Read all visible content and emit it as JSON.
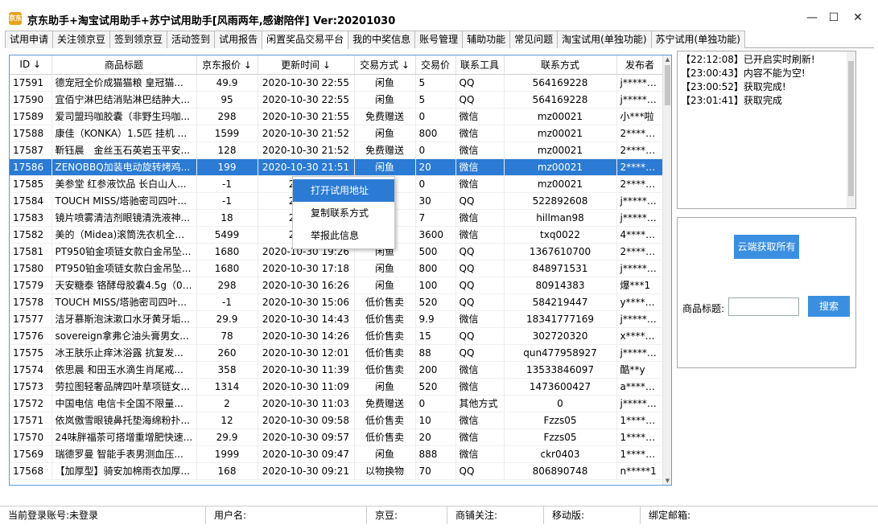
{
  "window": {
    "title": "京东助手+淘宝试用助手+苏宁试用助手[风雨两年,感谢陪伴] Ver:20201030",
    "icon_text": "京东"
  },
  "tabs": [
    {
      "label": "试用申请"
    },
    {
      "label": "关注领京豆"
    },
    {
      "label": "签到领京豆"
    },
    {
      "label": "活动签到"
    },
    {
      "label": "试用报告"
    },
    {
      "label": "闲置奖品交易平台",
      "active": true
    },
    {
      "label": "我的中奖信息"
    },
    {
      "label": "账号管理"
    },
    {
      "label": "辅助功能"
    },
    {
      "label": "常见问题"
    },
    {
      "label": "淘宝试用(单独功能)"
    },
    {
      "label": "苏宁试用(单独功能)"
    }
  ],
  "table": {
    "headers": [
      "ID ↓",
      "商品标题",
      "京东报价 ↓",
      "更新时间 ↓",
      "交易方式 ↓",
      "交易价",
      "联系工具",
      "联系方式",
      "发布者"
    ],
    "rows": [
      [
        "17591",
        "德宠冠全价成猫猫粮 皇冠猫...",
        "49.9",
        "2020-10-30 22:55",
        "闲鱼",
        "5",
        "QQ",
        "564169228",
        "j********"
      ],
      [
        "17590",
        "宜佰宁淋巴结消贴淋巴结肿大...",
        "95",
        "2020-10-30 22:55",
        "闲鱼",
        "5",
        "QQ",
        "564169228",
        "j********"
      ],
      [
        "17589",
        "爱司盟玛咖胶囊（非野生玛咖...",
        "298",
        "2020-10-30 21:55",
        "免费赠送",
        "0",
        "微信",
        "mz00021",
        "小***啦"
      ],
      [
        "17588",
        "康佳（KONKA）1.5匹 挂机 ...",
        "1599",
        "2020-10-30 21:52",
        "闲鱼",
        "800",
        "微信",
        "mz00021",
        "2********"
      ],
      [
        "17587",
        "靳钰晨　金丝玉石英岩玉平安...",
        "128",
        "2020-10-30 21:52",
        "免费赠送",
        "0",
        "微信",
        "mz00021",
        "2********"
      ],
      [
        "17586",
        "ZENOBBQ加装电动旋转烤鸡...",
        "199",
        "2020-10-30 21:51",
        "闲鱼",
        "20",
        "微信",
        "mz00021",
        "2********"
      ],
      [
        "17585",
        "美参堂 红参液饮品 长白山人...",
        "-1",
        "2020-1",
        "",
        "0",
        "微信",
        "mz00021",
        "2********"
      ],
      [
        "17584",
        "TOUCH MISS/塔驰密司四叶...",
        "-1",
        "2020-1",
        "",
        "30",
        "QQ",
        "522892608",
        "j********"
      ],
      [
        "17583",
        "镜片喷雾清洁剂眼镜清洗液神...",
        "18",
        "2020-1",
        "",
        "7",
        "微信",
        "hillman98",
        "j********"
      ],
      [
        "17582",
        "美的（Midea)滚筒洗衣机全自...",
        "5499",
        "2020-1",
        "",
        "3600",
        "微信",
        "txq0022",
        "4********"
      ],
      [
        "17581",
        "PT950铂金项链女款白金吊坠...",
        "1680",
        "2020-10-30 19:26",
        "闲鱼",
        "500",
        "QQ",
        "1367610700",
        "2********"
      ],
      [
        "17580",
        "PT950铂金项链女款白金吊坠...",
        "1680",
        "2020-10-30 17:18",
        "闲鱼",
        "800",
        "QQ",
        "848971531",
        "j********"
      ],
      [
        "17579",
        "天安糖泰 铬酵母胶囊4.5g（0....",
        "298",
        "2020-10-30 16:26",
        "闲鱼",
        "100",
        "QQ",
        "80914383",
        "爆***1"
      ],
      [
        "17578",
        "TOUCH MISS/塔驰密司四叶...",
        "-1",
        "2020-10-30 15:06",
        "低价售卖",
        "520",
        "QQ",
        "584219447",
        "y********"
      ],
      [
        "17577",
        "洁牙慕斯泡沫漱口水牙黄牙垢...",
        "29.9",
        "2020-10-30 14:43",
        "低价售卖",
        "9.9",
        "微信",
        "18341777169",
        "j********"
      ],
      [
        "17576",
        "sovereign拿弗仑油头膏男女...",
        "78",
        "2020-10-30 14:26",
        "低价售卖",
        "15",
        "QQ",
        "302720320",
        "x********m"
      ],
      [
        "17575",
        "冰王肤乐止痒沐浴露 抗复发...",
        "260",
        "2020-10-30 12:01",
        "低价售卖",
        "88",
        "QQ",
        "qun477958927",
        "j********"
      ],
      [
        "17574",
        "依思晨 和田玉水滴生肖尾戒...",
        "358",
        "2020-10-30 11:39",
        "低价售卖",
        "200",
        "微信",
        "13533846097",
        "酷**y"
      ],
      [
        "17573",
        "劳拉图轻奢品牌四叶草项链女...",
        "1314",
        "2020-10-30 11:09",
        "闲鱼",
        "520",
        "微信",
        "1473600427",
        "a********"
      ],
      [
        "17572",
        "中国电信 电信卡全国不限量...",
        "2",
        "2020-10-30 11:03",
        "免费赠送",
        "0",
        "其他方式",
        "0",
        "j********"
      ],
      [
        "17571",
        "依岚傲雪眼镜鼻托垫海绵粉扑...",
        "12",
        "2020-10-30 09:58",
        "低价售卖",
        "10",
        "微信",
        "Fzzs05",
        "1********"
      ],
      [
        "17570",
        "24味胖福茶可搭增重增肥快速...",
        "29.9",
        "2020-10-30 09:57",
        "低价售卖",
        "20",
        "微信",
        "Fzzs05",
        "1********"
      ],
      [
        "17569",
        "瑞德罗曼 智能手表男测血压...",
        "1999",
        "2020-10-30 09:47",
        "闲鱼",
        "888",
        "微信",
        "ckr0403",
        "1********"
      ],
      [
        "17568",
        "【加厚型】骑安加棉雨衣加厚...",
        "168",
        "2020-10-30 09:21",
        "以物换物",
        "70",
        "QQ",
        "806890748",
        "n*****1"
      ]
    ],
    "selected_index": 5
  },
  "context_menu": {
    "items": [
      "打开试用地址",
      "复制联系方式",
      "举报此信息"
    ],
    "hover_index": 0
  },
  "log": {
    "lines": [
      "【22:12:08】已开启实时刷新!",
      "【23:00:43】内容不能为空!",
      "【23:00:52】获取完成!",
      "【23:01:41】获取完成"
    ]
  },
  "panel": {
    "cloud_button": "云端获取所有",
    "search_label": "商品标题:",
    "search_button": "搜索",
    "search_value": ""
  },
  "statusbar": {
    "login": "当前登录账号:未登录",
    "username": "用户名:",
    "jingdou": "京豆:",
    "shop_follow": "商铺关注:",
    "mobile": "移动版:",
    "email": "绑定邮箱:"
  },
  "colors": {
    "accent": "#3b8fe0",
    "selection": "#2b7bd4",
    "grid_border": "#5a9bd5"
  }
}
